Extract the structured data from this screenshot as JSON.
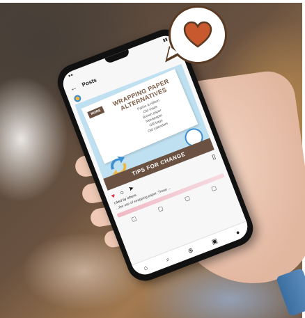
{
  "colors": {
    "bubble_outline": "#5a3a22",
    "heart": "#c8582e",
    "post_background": "#bfe0f0",
    "post_accent": "#6a5141",
    "like_heart": "#e3304a"
  },
  "phone": {
    "app_bar_title": "Posts",
    "post": {
      "tag": "MORE",
      "title_line1": "WRAPPING PAPER",
      "title_line2": "ALTERNATIVES",
      "alternatives": [
        "Fabric & ribbon",
        "Old maps",
        "Brown paper",
        "Newspaper",
        "Gift bags",
        "Old calendars"
      ],
      "cta": "TIPS FOR CHANGE"
    },
    "likes_text": "Liked by others",
    "caption_text": "...the use of wrapping paper. These ..."
  },
  "icons": {
    "bubble": "heart-speech-bubble-icon",
    "back": "back-arrow-icon",
    "like": "heart-icon",
    "comment": "comment-icon",
    "share": "send-icon",
    "save": "bookmark-icon",
    "recycle": "recycle-arrows-icon",
    "nav": [
      "home-icon",
      "search-icon",
      "add-icon",
      "shop-icon",
      "profile-icon"
    ]
  }
}
